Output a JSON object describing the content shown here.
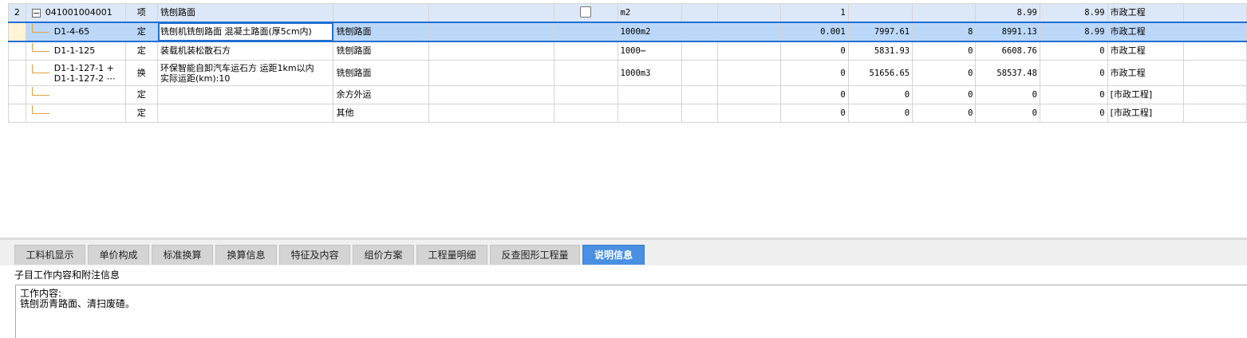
{
  "grid": {
    "rows": [
      {
        "num": "2",
        "code": "041001004001",
        "type": "项",
        "name": "铣刨路面",
        "subname": "",
        "unit": "m2",
        "qty": "1",
        "c10": "",
        "c11": "",
        "c12": "8.99",
        "c13": "8.99",
        "major": "市政工程",
        "has_checkbox": true
      },
      {
        "num": "",
        "code": "D1-4-65",
        "type": "定",
        "name": "铣刨机铣刨路面 混凝土路面(厚5cm内)",
        "subname": "铣刨路面",
        "unit": "1000m2",
        "qty": "0.001",
        "c10": "7997.61",
        "c11": "8",
        "c12": "8991.13",
        "c13": "8.99",
        "major": "市政工程"
      },
      {
        "num": "",
        "code": "D1-1-125",
        "type": "定",
        "name": "装载机装松散石方",
        "subname": "铣刨路面",
        "unit": "1000⋯",
        "qty": "0",
        "c10": "5831.93",
        "c11": "0",
        "c12": "6608.76",
        "c13": "0",
        "major": "市政工程"
      },
      {
        "num": "",
        "code": "D1-1-127-1 +",
        "code2": "D1-1-127-2 ⋯",
        "type": "换",
        "name": "环保智能自卸汽车运石方 运距1km以内",
        "name2": "实际运距(km):10",
        "subname": "铣刨路面",
        "unit": "1000m3",
        "qty": "0",
        "c10": "51656.65",
        "c11": "0",
        "c12": "58537.48",
        "c13": "0",
        "major": "市政工程"
      },
      {
        "num": "",
        "code": "",
        "type": "定",
        "name": "",
        "subname": "余方外运",
        "unit": "",
        "qty": "0",
        "c10": "0",
        "c11": "0",
        "c12": "0",
        "c13": "0",
        "major": "[市政工程]"
      },
      {
        "num": "",
        "code": "",
        "type": "定",
        "name": "",
        "subname": "其他",
        "unit": "",
        "qty": "0",
        "c10": "0",
        "c11": "0",
        "c12": "0",
        "c13": "0",
        "major": "[市政工程]"
      }
    ]
  },
  "tabs": {
    "items": [
      "工料机显示",
      "单价构成",
      "标准换算",
      "换算信息",
      "特征及内容",
      "组价方案",
      "工程量明细",
      "反查图形工程量",
      "说明信息"
    ],
    "active_index": 8
  },
  "panel": {
    "title": "子目工作内容和附注信息",
    "line1": "工作内容:",
    "line2": "铣刨沥青路面、清扫废碴。"
  },
  "colors": {
    "accent": "#4a90e2",
    "selected_row": "#bcd8f8",
    "parent_row": "#dce8f7"
  }
}
